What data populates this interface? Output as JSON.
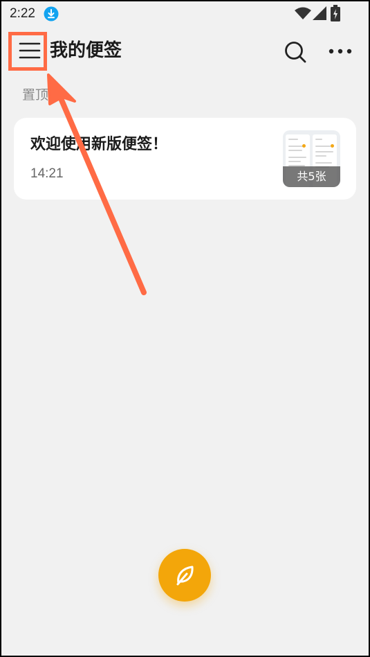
{
  "status_bar": {
    "time": "2:22",
    "icons": [
      "download-icon",
      "wifi-icon",
      "signal-icon",
      "battery-charging-icon"
    ]
  },
  "header": {
    "title": "我的便签",
    "left_icon": "hamburger-menu-icon",
    "right_icons": [
      "search-icon",
      "more-dots-icon"
    ]
  },
  "section": {
    "label": "置顶"
  },
  "notes": [
    {
      "title": "欢迎使用新版便签！",
      "time": "14:21",
      "thumbnail_count_label": "共5张"
    }
  ],
  "fab": {
    "icon": "feather-pen-icon"
  },
  "colors": {
    "background": "#f1f1f1",
    "card": "#ffffff",
    "accent": "#f3a60a",
    "annotation": "#ff6b45"
  }
}
